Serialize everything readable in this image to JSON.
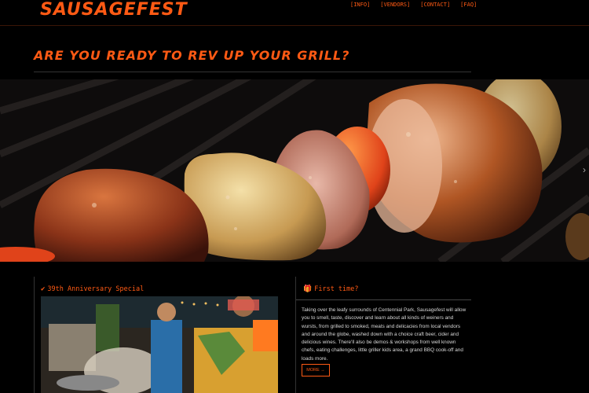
{
  "header": {
    "logo": "SAUSAGEFEST",
    "nav": [
      {
        "label": "[INFO]"
      },
      {
        "label": "[VENDORS]"
      },
      {
        "label": "[CONTACT]"
      },
      {
        "label": "[FAQ]"
      }
    ]
  },
  "headline": "ARE YOU READY TO REV UP YOUR GRILL?",
  "hero": {
    "next_icon": "›",
    "image": "grilled-sausage-skewer"
  },
  "anniversary": {
    "icon": "check-icon",
    "icon_glyph": "✔",
    "title": "39th Anniversary Special"
  },
  "first_time": {
    "icon": "gift-icon",
    "icon_glyph": "🎁",
    "title": "First time?",
    "body": "Taking over the leafy surrounds of Centennial Park, Sausagefest will allow you to smell, taste, discover and learn about all kinds of weiners and wursts, from grilled to smoked, meats and delicacies from local vendors and around the globe, washed down with a choice craft beer, cider and delicious wines. There'll also be demos & workshops from well known chefs, eating challenges, little griller kids area, a grand BBQ cook-off and loads more.",
    "more_label": "MORE →"
  },
  "colors": {
    "accent": "#ff5a14",
    "background": "#000000"
  }
}
